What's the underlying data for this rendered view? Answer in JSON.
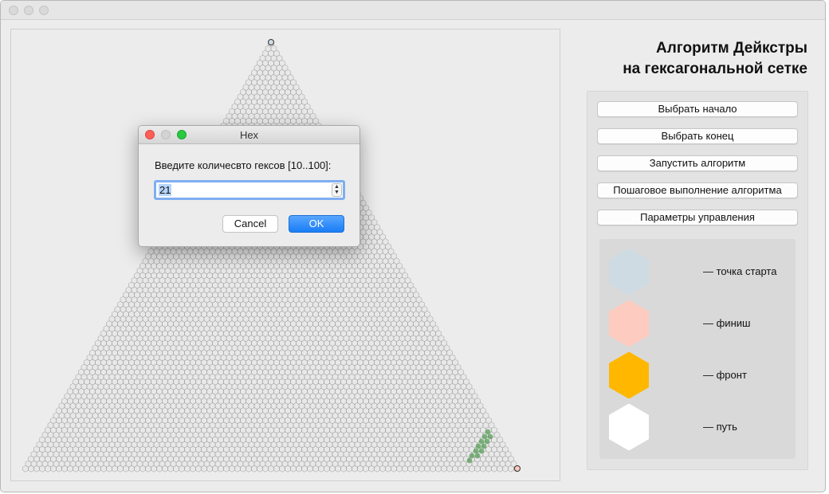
{
  "app": {
    "title_line1": "Алгоритм Дейкстры",
    "title_line2": "на гексагональной сетке"
  },
  "controls": {
    "buttons": [
      {
        "label": "Выбрать начало"
      },
      {
        "label": "Выбрать конец"
      },
      {
        "label": "Запустить алгоритм"
      },
      {
        "label": "Пошаговое выполнение алгоритма"
      },
      {
        "label": "Параметры управления"
      }
    ]
  },
  "legend": [
    {
      "label": "— точка старта",
      "color": "#cfdbe3"
    },
    {
      "label": "— финиш",
      "color": "#fdcbbf"
    },
    {
      "label": "— фронт",
      "color": "#ffb700"
    },
    {
      "label": "— путь",
      "color": "#ffffff"
    }
  ],
  "dialog": {
    "title": "Hex",
    "prompt": "Введите количесвто гексов [10..100]:",
    "value": "21",
    "cancel_label": "Cancel",
    "ok_label": "OK"
  },
  "colors": {
    "hex_fill": "#e8e8e8",
    "hex_stroke": "#9c9c9c",
    "path_green": "#5a9e5a",
    "ok_blue": "#1a7df6"
  }
}
